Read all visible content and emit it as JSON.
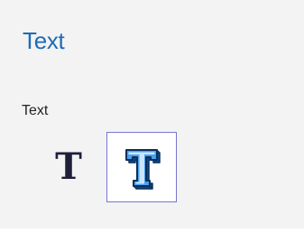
{
  "panel": {
    "title": "Text"
  },
  "text_section": {
    "label": "Text",
    "styles": [
      {
        "glyph": "T",
        "icon": "plain-text-icon",
        "selected": false
      },
      {
        "glyph": "T",
        "icon": "3d-text-icon",
        "selected": true
      }
    ]
  },
  "colors": {
    "title": "#1e6bb8",
    "panel_background": "#f3f3f3",
    "selection_border": "#7777cc",
    "glyph_3d_face": "#3a8fe0",
    "glyph_3d_side": "#0b4a8a"
  }
}
